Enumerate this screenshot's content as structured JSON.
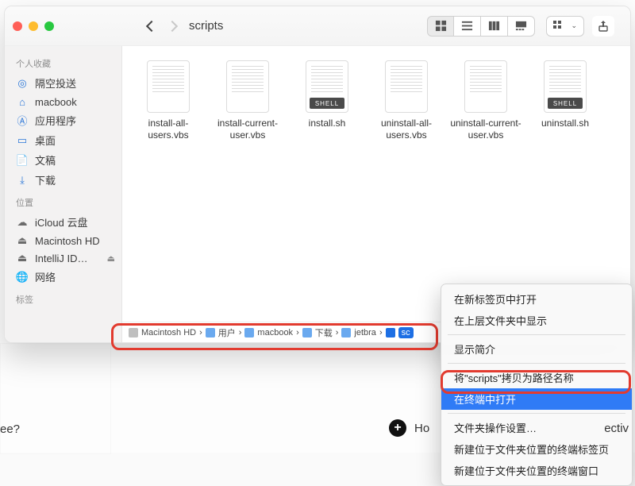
{
  "window": {
    "title": "scripts"
  },
  "sidebar": {
    "sections": [
      {
        "label": "个人收藏",
        "items": [
          {
            "icon": "airdrop",
            "label": "隔空投送"
          },
          {
            "icon": "home",
            "label": "macbook"
          },
          {
            "icon": "apps",
            "label": "应用程序"
          },
          {
            "icon": "desktop",
            "label": "桌面"
          },
          {
            "icon": "docs",
            "label": "文稿"
          },
          {
            "icon": "downloads",
            "label": "下载"
          }
        ]
      },
      {
        "label": "位置",
        "items": [
          {
            "icon": "cloud",
            "label": "iCloud 云盘"
          },
          {
            "icon": "disk",
            "label": "Macintosh HD"
          },
          {
            "icon": "disk",
            "label": "IntelliJ ID…",
            "eject": true
          },
          {
            "icon": "globe",
            "label": "网络"
          }
        ]
      },
      {
        "label": "标签",
        "items": []
      }
    ]
  },
  "files": [
    {
      "name": "install-all-users.vbs",
      "kind": "vbs"
    },
    {
      "name": "install-current-user.vbs",
      "kind": "vbs"
    },
    {
      "name": "install.sh",
      "kind": "sh"
    },
    {
      "name": "uninstall-all-users.vbs",
      "kind": "vbs"
    },
    {
      "name": "uninstall-current-user.vbs",
      "kind": "vbs"
    },
    {
      "name": "uninstall.sh",
      "kind": "sh"
    }
  ],
  "sh_badge": "SHELL",
  "path": [
    {
      "label": "Macintosh HD",
      "kind": "disk"
    },
    {
      "label": "用户",
      "kind": "folder"
    },
    {
      "label": "macbook",
      "kind": "folder"
    },
    {
      "label": "下载",
      "kind": "folder"
    },
    {
      "label": "jetbra",
      "kind": "folder"
    },
    {
      "label": "sc",
      "kind": "folder",
      "selected": true
    }
  ],
  "contextmenu": {
    "items": [
      {
        "label": "在新标签页中打开"
      },
      {
        "label": "在上层文件夹中显示"
      },
      {
        "sep": true
      },
      {
        "label": "显示简介"
      },
      {
        "sep": true
      },
      {
        "label": "将\"scripts\"拷贝为路径名称"
      },
      {
        "label": "在终端中打开",
        "selected": true
      },
      {
        "sep": true
      },
      {
        "label": "文件夹操作设置…"
      },
      {
        "label": "新建位于文件夹位置的终端标签页"
      },
      {
        "label": "新建位于文件夹位置的终端窗口"
      }
    ]
  },
  "bottom": {
    "left": "ee?",
    "mid_left": "Ho",
    "mid_right": "ectiv"
  }
}
